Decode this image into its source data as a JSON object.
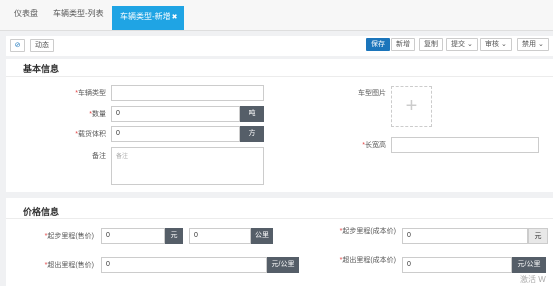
{
  "tabs": [
    "仪表盘",
    "车辆类型-列表",
    "车辆类型-新增"
  ],
  "tab_close": "✖",
  "toolbar": {
    "dynamic": "动态",
    "save": "保存",
    "add": "新增",
    "copy": "复制",
    "submit": "提交",
    "review": "审核",
    "disable": "禁用"
  },
  "basic": {
    "title": "基本信息",
    "fields": {
      "vehicle_type": "车辆类型",
      "quantity": "数量",
      "quantity_unit": "吨",
      "quantity_value": "0",
      "volume": "载货体积",
      "volume_unit": "方",
      "volume_value": "0",
      "remark": "备注",
      "remark_placeholder": "备注",
      "vehicle_image": "车型图片",
      "dimensions": "长宽高"
    }
  },
  "price": {
    "title": "价格信息",
    "start_price": "起步里程(售价)",
    "start_cost": "起步里程(成本价)",
    "extra_price": "超出里程(售价)",
    "extra_cost": "超出里程(成本价)",
    "unit_yuan": "元",
    "unit_km": "公里",
    "unit_yuan_per_km": "元/公里",
    "zero": "0"
  },
  "watermark": "激活 W"
}
